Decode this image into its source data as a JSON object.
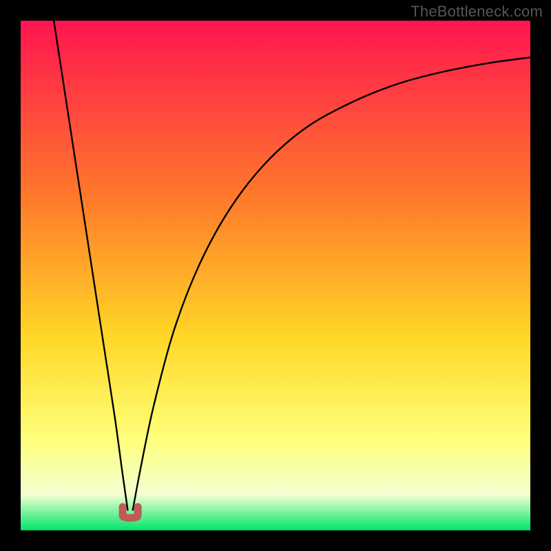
{
  "watermark": "TheBottleneck.com",
  "chart_data": {
    "type": "line",
    "title": "",
    "xlabel": "",
    "ylabel": "",
    "xlim": [
      0,
      1
    ],
    "ylim": [
      0,
      1
    ],
    "grid": false,
    "legend": false,
    "x_min_point": 0.215,
    "series": [
      {
        "name": "left-branch",
        "x": [
          0.065,
          0.085,
          0.105,
          0.125,
          0.145,
          0.165,
          0.185,
          0.2,
          0.21
        ],
        "y": [
          1.0,
          0.87,
          0.74,
          0.61,
          0.48,
          0.35,
          0.22,
          0.11,
          0.04
        ]
      },
      {
        "name": "right-branch",
        "x": [
          0.22,
          0.235,
          0.26,
          0.3,
          0.35,
          0.41,
          0.48,
          0.56,
          0.65,
          0.74,
          0.83,
          0.92,
          1.0
        ],
        "y": [
          0.04,
          0.12,
          0.24,
          0.39,
          0.52,
          0.63,
          0.72,
          0.79,
          0.84,
          0.876,
          0.9,
          0.917,
          0.928
        ]
      }
    ],
    "marker": {
      "name": "min-marker",
      "x": 0.215,
      "y": 0.015,
      "color": "#c05a56"
    },
    "background_gradient": {
      "top": "#ff1550",
      "mid1": "#ff7a2a",
      "mid2": "#ffd726",
      "low": "#ffff7a",
      "pale": "#f3ffd1",
      "green": "#00e66a"
    }
  }
}
